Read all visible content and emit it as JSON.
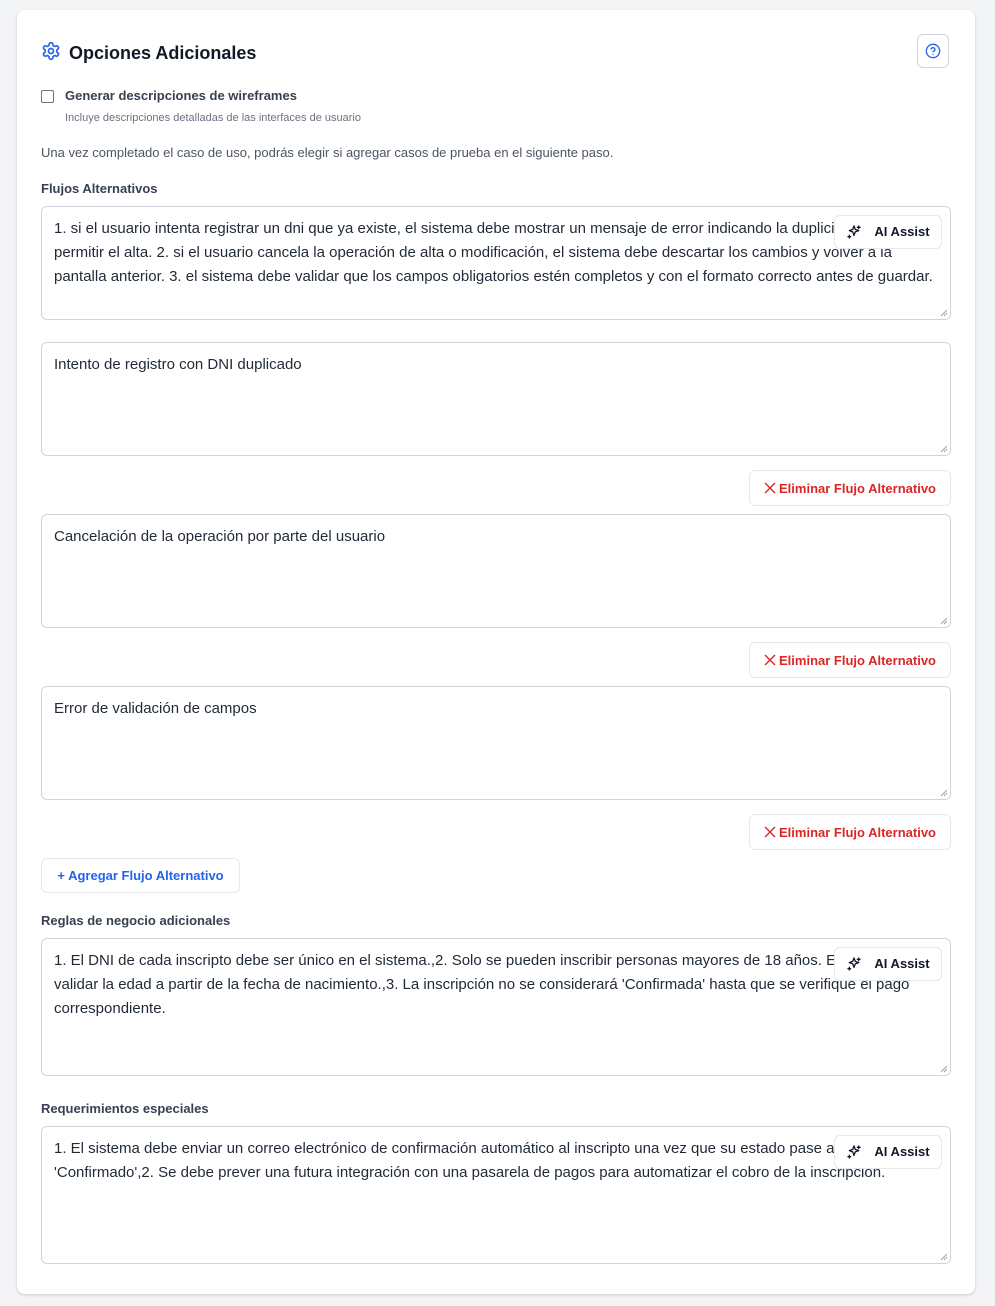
{
  "section": {
    "title": "Opciones Adicionales",
    "icon": "gear-icon",
    "accent": "#2563eb"
  },
  "help": {
    "icon": "help-circle-icon"
  },
  "wireframes": {
    "checked": false,
    "label": "Generar descripciones de wireframes",
    "help": "Incluye descripciones detalladas de las interfaces de usuario"
  },
  "info_text": "Una vez completado el caso de uso, podrás elegir si agregar casos de prueba en el siguiente paso.",
  "alt_flows": {
    "label": "Flujos Alternativos",
    "main_value": "1. si el usuario intenta registrar un dni que ya existe, el sistema debe mostrar un mensaje de error indicando la duplicidad y no permitir el alta. 2. si el usuario cancela la operación de alta o modificación, el sistema debe descartar los cambios y volver a la pantalla anterior. 3. el sistema debe validar que los campos obligatorios estén completos y con el formato correcto antes de guardar.",
    "ai_label": "AI Assist",
    "items": [
      {
        "value": "Intento de registro con DNI duplicado",
        "delete_label": "Eliminar Flujo Alternativo"
      },
      {
        "value": "Cancelación de la operación por parte del usuario",
        "delete_label": "Eliminar Flujo Alternativo"
      },
      {
        "value": "Error de validación de campos",
        "delete_label": "Eliminar Flujo Alternativo"
      }
    ],
    "add_label": "+ Agregar Flujo Alternativo",
    "delete_color": "#dc2626"
  },
  "business_rules": {
    "label": "Reglas de negocio adicionales",
    "value": "1. El DNI de cada inscripto debe ser único en el sistema.,2. Solo se pueden inscribir personas mayores de 18 años. El sistema debe validar la edad a partir de la fecha de nacimiento.,3. La inscripción no se considerará 'Confirmada' hasta que se verifique el pago correspondiente.",
    "ai_label": "AI Assist"
  },
  "special_reqs": {
    "label": "Requerimientos especiales",
    "value": "1. El sistema debe enviar un correo electrónico de confirmación automático al inscripto una vez que su estado pase a 'Confirmado',2. Se debe prever una futura integración con una pasarela de pagos para automatizar el cobro de la inscripción.",
    "ai_label": "AI Assist"
  }
}
